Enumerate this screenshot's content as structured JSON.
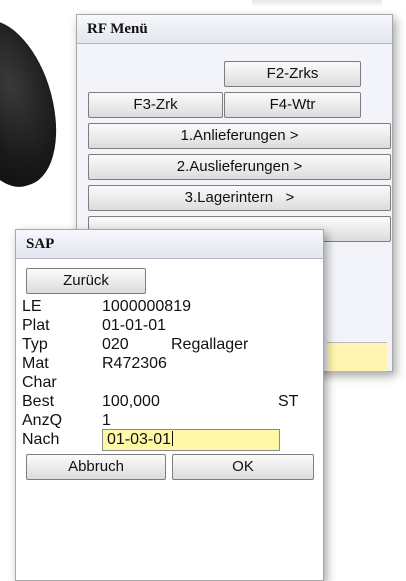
{
  "rf_window": {
    "title": "RF Menü",
    "buttons": {
      "f2": "F2-Zrks",
      "f3": "F3-Zrk",
      "f4": "F4-Wtr",
      "anlieferungen": "1.Anlieferungen >",
      "auslieferungen": "2.Auslieferungen >",
      "lagerintern": "3.Lagerintern   >"
    }
  },
  "sap_window": {
    "title": "SAP",
    "back_button": "Zurück",
    "fields": {
      "le": {
        "label": "LE",
        "value": "1000000819"
      },
      "plat": {
        "label": "Plat",
        "value": "01-01-01"
      },
      "typ": {
        "label": "Typ",
        "value": "020",
        "description": "Regallager"
      },
      "mat": {
        "label": "Mat",
        "value": "R472306"
      },
      "char": {
        "label": "Char",
        "value": ""
      },
      "best": {
        "label": "Best",
        "value": "100,000",
        "unit": "ST"
      },
      "anzq": {
        "label": "AnzQ",
        "value": "1"
      },
      "nach": {
        "label": "Nach",
        "value": "01-03-01"
      }
    },
    "cancel_button": "Abbruch",
    "ok_button": "OK"
  },
  "colors": {
    "input_highlight": "#fff8a6",
    "title_bar": "#e2e6ef",
    "rf_body": "#f2f4fa"
  }
}
